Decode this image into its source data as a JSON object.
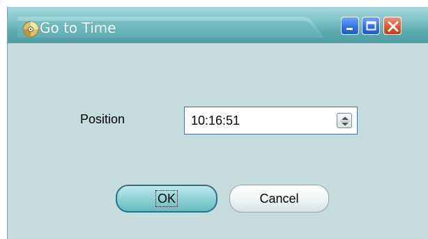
{
  "window": {
    "title": "Go to Time",
    "icon": "disc-icon",
    "controls": {
      "minimize_icon": "minimize-icon",
      "maximize_icon": "maximize-icon",
      "close_icon": "close-icon"
    }
  },
  "form": {
    "position_label": "Position",
    "position_value": "10:16:51",
    "spinner_icon": "spinner-updown-icon"
  },
  "buttons": {
    "ok_label": "OK",
    "cancel_label": "Cancel"
  },
  "colors": {
    "titlebar": "#5aa9ae",
    "window_bg": "#c6dbdb",
    "minimize_maximize": "#2f6fe6",
    "close": "#e0542d",
    "ok_button": "#8fd3d7"
  }
}
